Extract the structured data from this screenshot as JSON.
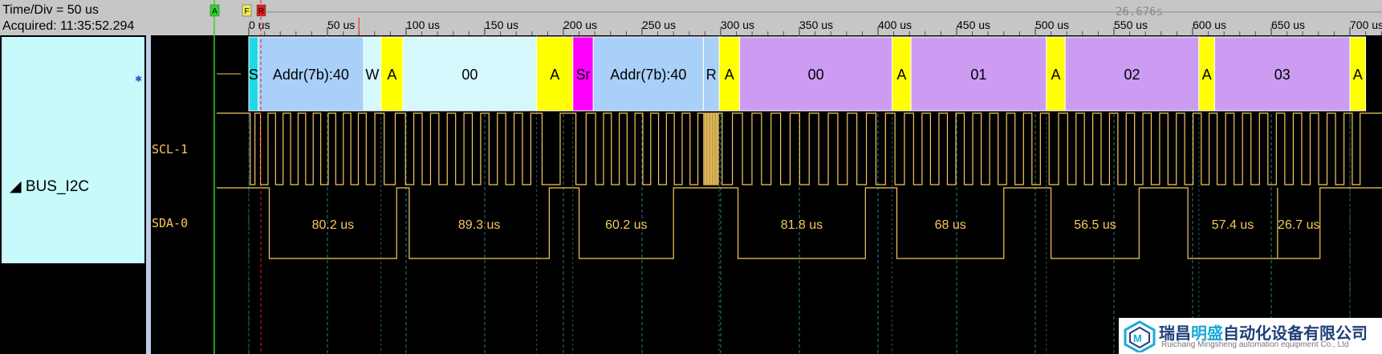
{
  "header": {
    "time_div": "Time/Div = 50 us",
    "acquired": "Acquired: 11:35:52.294",
    "cursor_delta": "26.676s",
    "marker_a": "A",
    "marker_f": "F",
    "marker_r": "R"
  },
  "ruler": {
    "ticks": [
      "0 us",
      "50 us",
      "100 us",
      "150 us",
      "200 us",
      "250 us",
      "300 us",
      "350 us",
      "400 us",
      "450 us",
      "500 us",
      "550 us",
      "600 us",
      "650 us",
      "700 us"
    ]
  },
  "bus": {
    "name": "BUS_I2C",
    "type": "I2C"
  },
  "signals": {
    "scl": "SCL-1",
    "sda": "SDA-0"
  },
  "decode": [
    {
      "label": "S",
      "start": 0,
      "end": 6,
      "kind": "start"
    },
    {
      "label": "Addr(7b):40",
      "start": 6,
      "end": 73,
      "kind": "addr"
    },
    {
      "label": "W",
      "start": 73,
      "end": 84,
      "kind": "rw"
    },
    {
      "label": "A",
      "start": 84,
      "end": 98,
      "kind": "ack"
    },
    {
      "label": "00",
      "start": 98,
      "end": 183,
      "kind": "data-write"
    },
    {
      "label": "A",
      "start": 183,
      "end": 206,
      "kind": "ack"
    },
    {
      "label": "Sr",
      "start": 206,
      "end": 219,
      "kind": "sr"
    },
    {
      "label": "Addr(7b):40",
      "start": 219,
      "end": 289,
      "kind": "addr"
    },
    {
      "label": "R",
      "start": 289,
      "end": 299,
      "kind": "addr"
    },
    {
      "label": "A",
      "start": 299,
      "end": 312,
      "kind": "ack"
    },
    {
      "label": "00",
      "start": 312,
      "end": 409,
      "kind": "data-read"
    },
    {
      "label": "A",
      "start": 409,
      "end": 421,
      "kind": "ack"
    },
    {
      "label": "01",
      "start": 421,
      "end": 507,
      "kind": "data-read"
    },
    {
      "label": "A",
      "start": 507,
      "end": 519,
      "kind": "ack"
    },
    {
      "label": "02",
      "start": 519,
      "end": 604,
      "kind": "data-read"
    },
    {
      "label": "A",
      "start": 604,
      "end": 614,
      "kind": "ack"
    },
    {
      "label": "03",
      "start": 614,
      "end": 700,
      "kind": "data-read"
    },
    {
      "label": "A",
      "start": 700,
      "end": 710,
      "kind": "ack"
    }
  ],
  "sda_low": [
    {
      "start": 13,
      "end": 94,
      "label": "80.2 us"
    },
    {
      "start": 102,
      "end": 191,
      "label": "89.3 us"
    },
    {
      "start": 210,
      "end": 270,
      "label": "60.2 us"
    },
    {
      "start": 311,
      "end": 392,
      "label": "81.8 us"
    },
    {
      "start": 412,
      "end": 480,
      "label": "68 us"
    },
    {
      "start": 510,
      "end": 566,
      "label": "56.5 us"
    },
    {
      "start": 597,
      "end": 654,
      "label": "57.4 us"
    },
    {
      "start": 654,
      "end": 681,
      "label": "26.7 us"
    }
  ],
  "colors": {
    "start": "#1fd9e6",
    "addr": "#a8d0f8",
    "rw": "#d4f8fb",
    "ack": "#ffff00",
    "data-write": "#d4f8fb",
    "data-read": "#cc9cf2",
    "sr": "#ff00ff",
    "trace": "#f6c85f",
    "grid": "#2c7b7b",
    "cursor": "#e31b1b",
    "label": "#f6c85f"
  },
  "logo": {
    "cn_a": "瑞昌",
    "cn_b": "明盛",
    "cn_c": "自动化设备有限公司",
    "en": "Ruichang Mingsheng automation equipment Co., Ltd"
  }
}
